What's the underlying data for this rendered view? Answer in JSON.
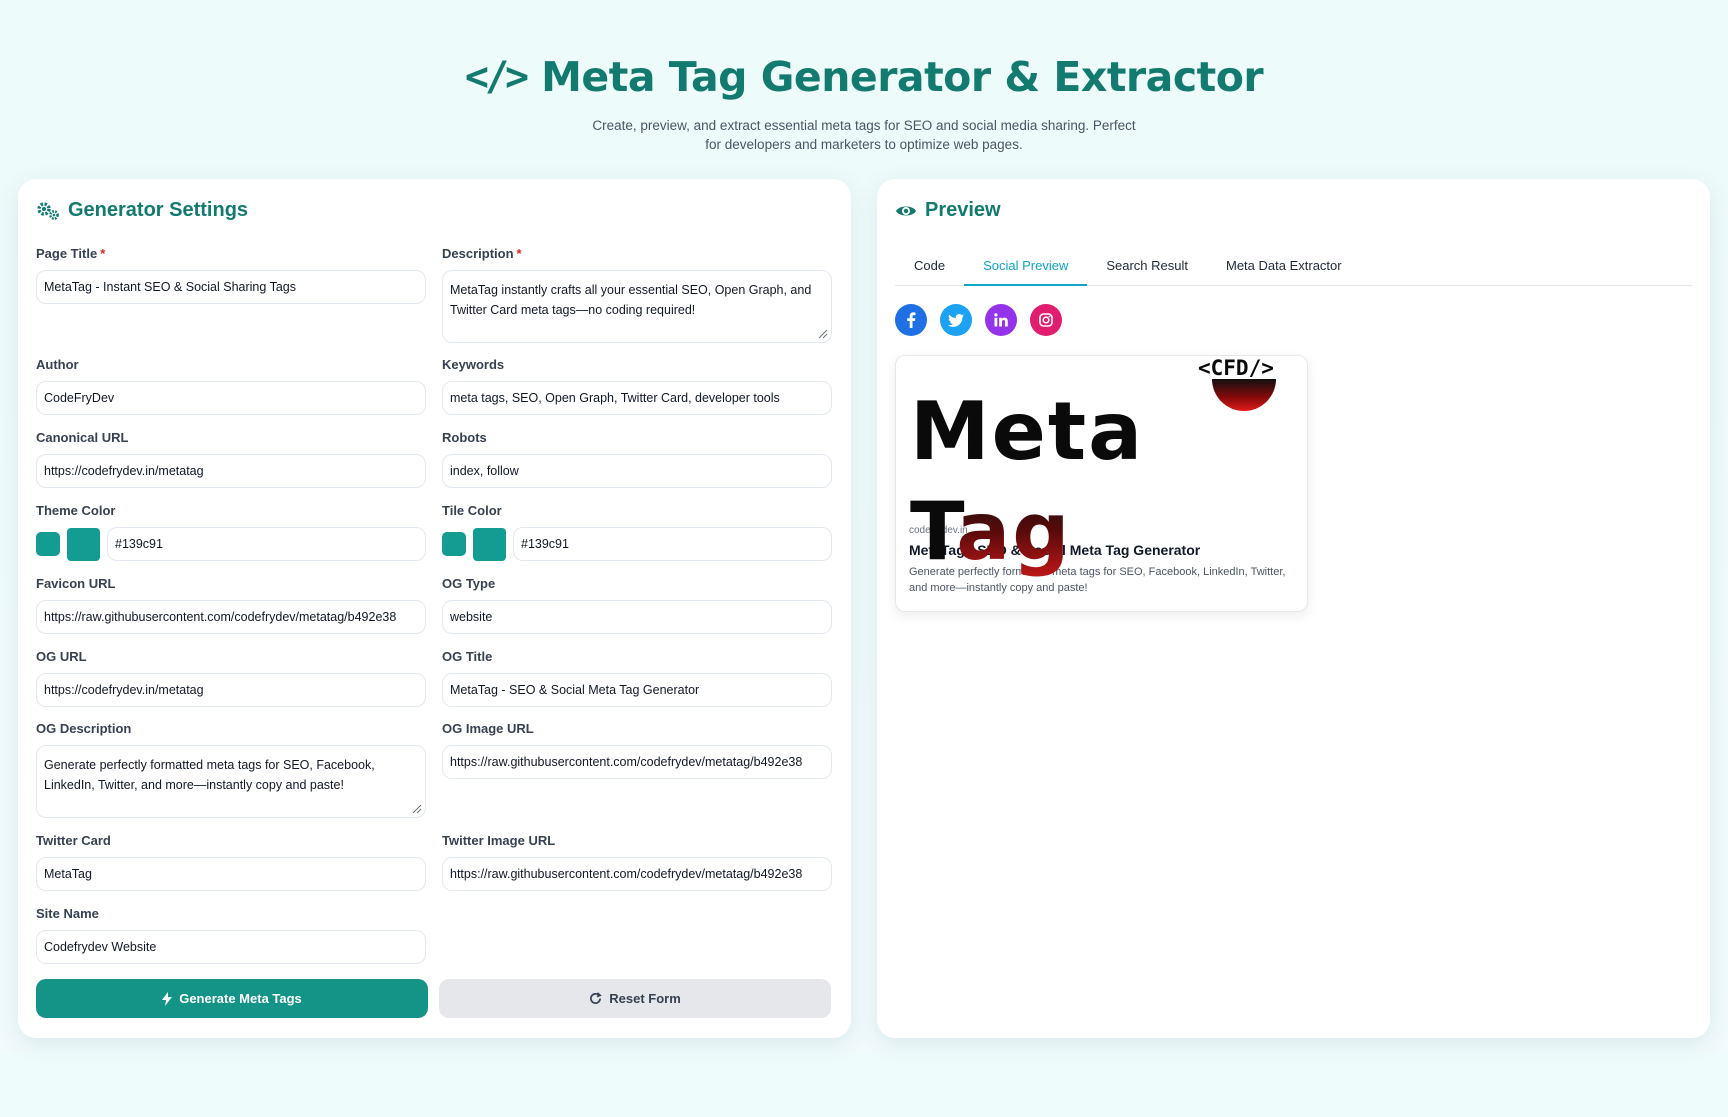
{
  "header": {
    "icon": "code-icon",
    "title": "Meta Tag Generator & Extractor",
    "subtitle": "Create, preview, and extract essential meta tags for SEO and social media sharing. Perfect for developers and marketers to optimize web pages."
  },
  "generator": {
    "heading": "Generator Settings",
    "fields": {
      "page_title": {
        "label": "Page Title",
        "required": "*",
        "value": "MetaTag - Instant SEO & Social Sharing Tags"
      },
      "description": {
        "label": "Description",
        "required": "*",
        "value": "MetaTag instantly crafts all your essential SEO, Open Graph, and Twitter Card meta tags—no coding required!"
      },
      "author": {
        "label": "Author",
        "value": "CodeFryDev"
      },
      "keywords": {
        "label": "Keywords",
        "value": "meta tags, SEO, Open Graph, Twitter Card, developer tools"
      },
      "canonical_url": {
        "label": "Canonical URL",
        "value": "https://codefrydev.in/metatag"
      },
      "robots": {
        "label": "Robots",
        "value": "index, follow"
      },
      "theme_color": {
        "label": "Theme Color",
        "value": "#139c91"
      },
      "tile_color": {
        "label": "Tile Color",
        "value": "#139c91"
      },
      "favicon_url": {
        "label": "Favicon URL",
        "value": "https://raw.githubusercontent.com/codefrydev/metatag/b492e38"
      },
      "og_type": {
        "label": "OG Type",
        "value": "website"
      },
      "og_url": {
        "label": "OG URL",
        "value": "https://codefrydev.in/metatag"
      },
      "og_title": {
        "label": "OG Title",
        "value": "MetaTag - SEO & Social Meta Tag Generator"
      },
      "og_description": {
        "label": "OG Description",
        "value": "Generate perfectly formatted meta tags for SEO, Facebook, LinkedIn, Twitter, and more—instantly copy and paste!"
      },
      "og_image_url": {
        "label": "OG Image URL",
        "value": "https://raw.githubusercontent.com/codefrydev/metatag/b492e38"
      },
      "twitter_card": {
        "label": "Twitter Card",
        "value": "MetaTag"
      },
      "twitter_image_url": {
        "label": "Twitter Image URL",
        "value": "https://raw.githubusercontent.com/codefrydev/metatag/b492e38"
      },
      "site_name": {
        "label": "Site Name",
        "value": "Codefrydev Website"
      }
    },
    "buttons": {
      "generate": "Generate Meta Tags",
      "reset": "Reset Form"
    }
  },
  "preview": {
    "heading": "Preview",
    "tabs": [
      {
        "label": "Code",
        "active": false
      },
      {
        "label": "Social Preview",
        "active": true
      },
      {
        "label": "Search Result",
        "active": false
      },
      {
        "label": "Meta Data Extractor",
        "active": false
      }
    ],
    "social_icons": [
      "facebook-icon",
      "twitter-icon",
      "linkedin-icon",
      "instagram-icon"
    ],
    "card": {
      "logo_text_main": "Meta T",
      "logo_text_accent": "ag",
      "logo_badge": "<CFD/>",
      "domain": "codefrydev.in",
      "title": "MetaTag - SEO & Social Meta Tag Generator",
      "description": "Generate perfectly formatted meta tags for SEO, Facebook, LinkedIn, Twitter, and more—instantly copy and paste!"
    }
  },
  "colors": {
    "brand": "#127a6e",
    "button": "#139486",
    "tab_active": "#0ea5c6",
    "swatch": "#139c91"
  }
}
